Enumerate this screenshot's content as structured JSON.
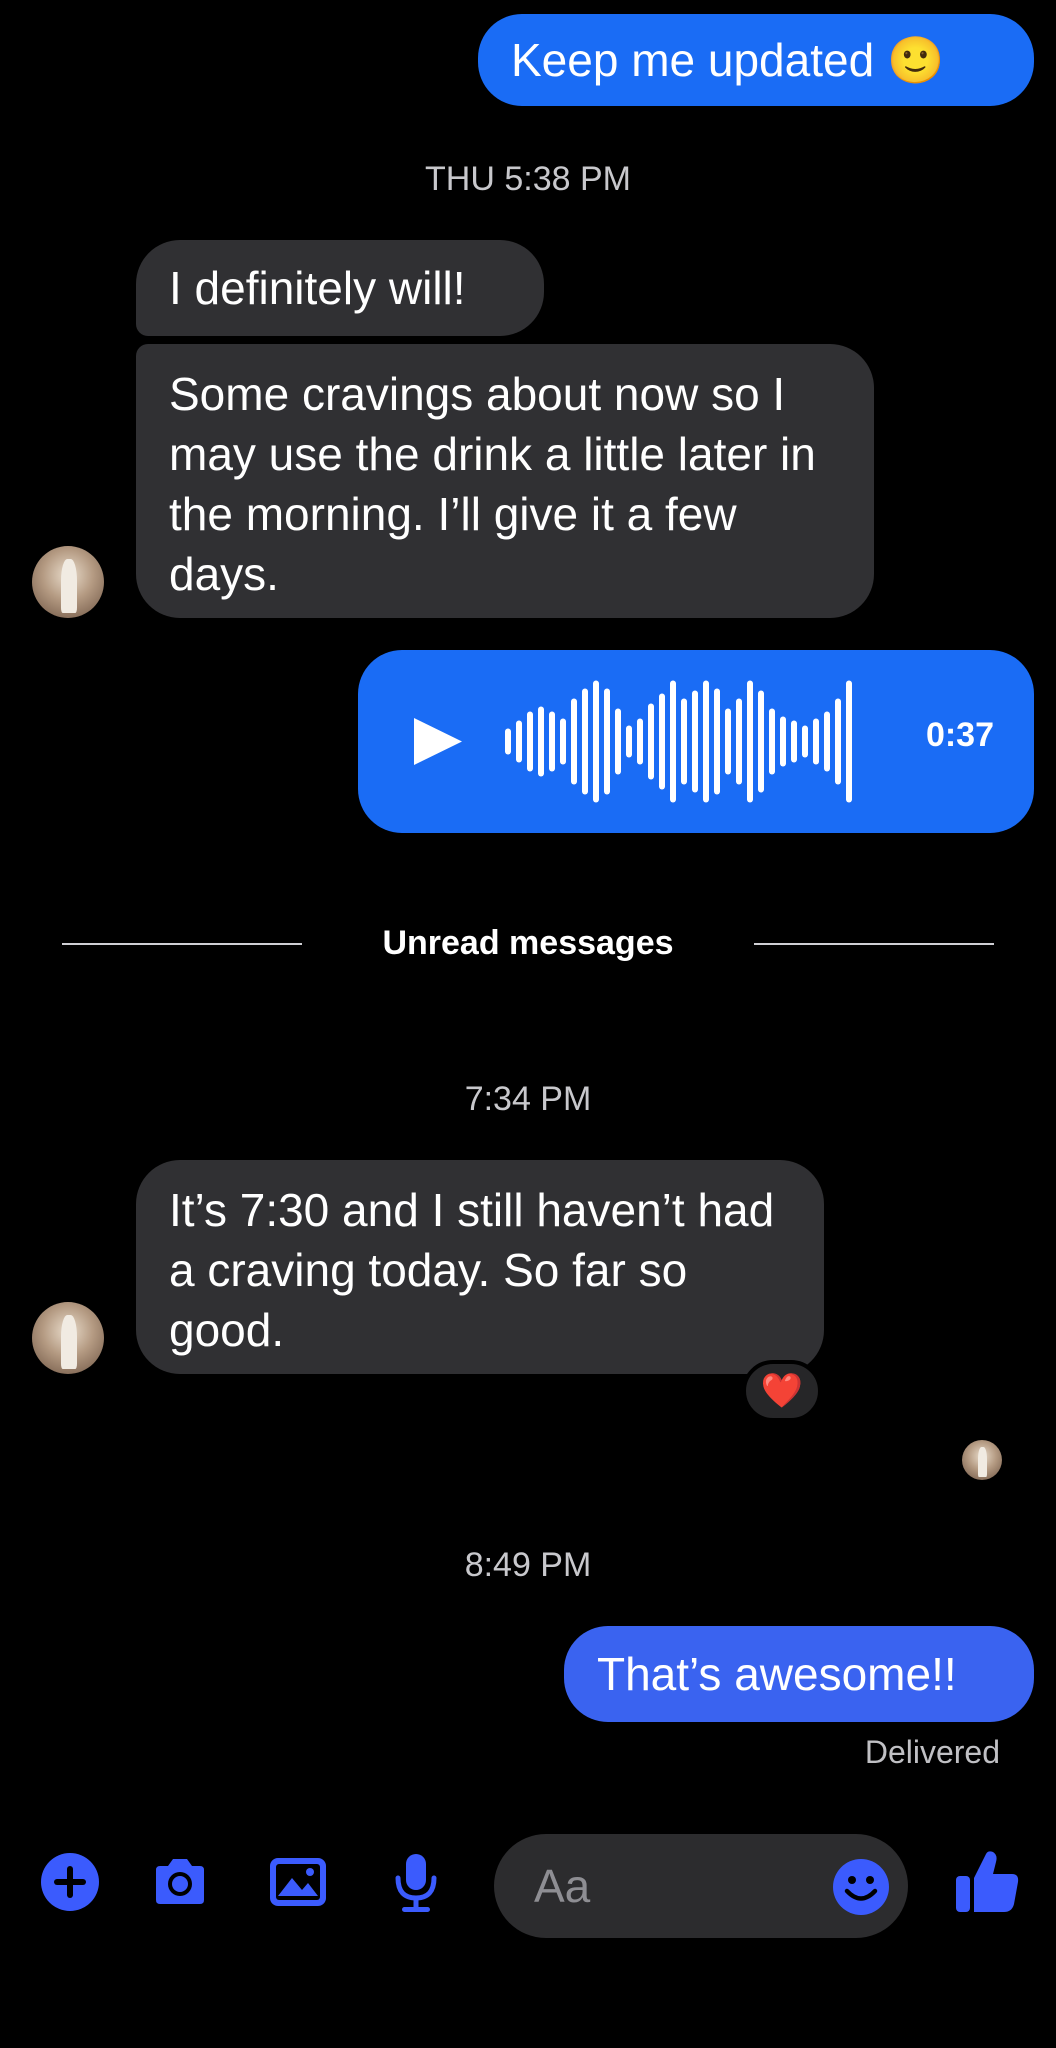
{
  "colors": {
    "outgoing": "#1a6cf5",
    "incoming": "#303033",
    "accent": "#3b5bfd"
  },
  "messages": {
    "m1": "Keep me updated 🙂",
    "ts1": "THU 5:38 PM",
    "m2": "I definitely will!",
    "m3": "Some cravings about now so I may use the drink a little later in the morning. I’ll give it a few days.",
    "voice_duration": "0:37",
    "unread_label": "Unread messages",
    "ts2": "7:34 PM",
    "m4": "It’s 7:30 and I still haven’t had a craving today. So far so good.",
    "reaction": "❤️",
    "ts3": "8:49 PM",
    "m5": "That’s awesome!!",
    "status": "Delivered"
  },
  "composer": {
    "placeholder": "Aa",
    "icons": [
      "plus-icon",
      "camera-icon",
      "image-icon",
      "microphone-icon",
      "emoji-icon",
      "thumbs-up-icon"
    ]
  }
}
